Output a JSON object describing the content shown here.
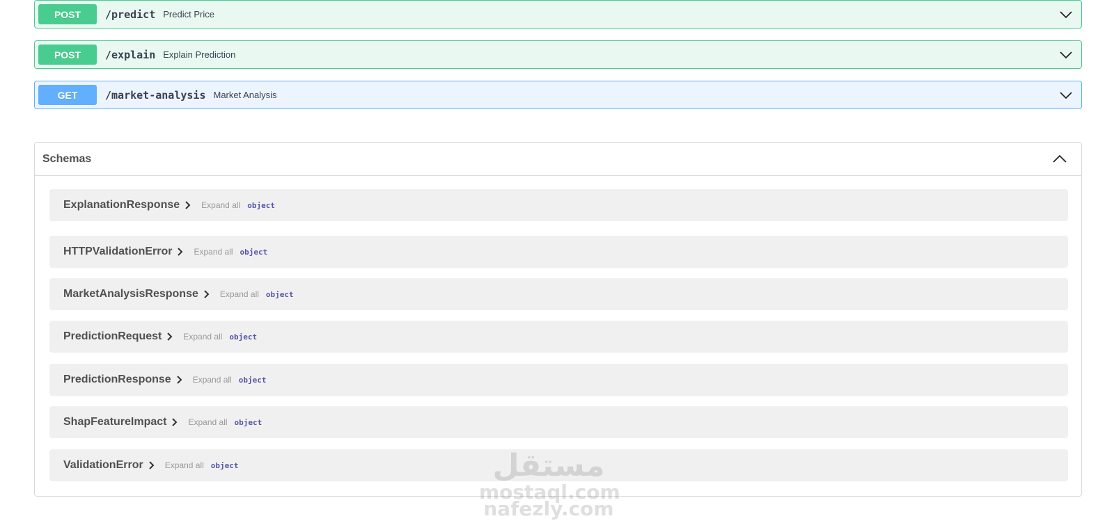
{
  "operations": [
    {
      "method": "POST",
      "path": "/predict",
      "summary": "Predict Price"
    },
    {
      "method": "POST",
      "path": "/explain",
      "summary": "Explain Prediction"
    },
    {
      "method": "GET",
      "path": "/market-analysis",
      "summary": "Market Analysis"
    }
  ],
  "schemas": {
    "title": "Schemas",
    "models": [
      {
        "name": "ExplanationResponse",
        "expand": "Expand all",
        "type": "object"
      },
      {
        "name": "HTTPValidationError",
        "expand": "Expand all",
        "type": "object"
      },
      {
        "name": "MarketAnalysisResponse",
        "expand": "Expand all",
        "type": "object"
      },
      {
        "name": "PredictionRequest",
        "expand": "Expand all",
        "type": "object"
      },
      {
        "name": "PredictionResponse",
        "expand": "Expand all",
        "type": "object"
      },
      {
        "name": "ShapFeatureImpact",
        "expand": "Expand all",
        "type": "object"
      },
      {
        "name": "ValidationError",
        "expand": "Expand all",
        "type": "object"
      }
    ]
  },
  "watermark": {
    "arabic": "مستقل",
    "line1": "mostaql.com",
    "line2": "nafezly.com"
  },
  "colors": {
    "post": "#49cc90",
    "get": "#61affe",
    "schema_type": "#55a"
  }
}
